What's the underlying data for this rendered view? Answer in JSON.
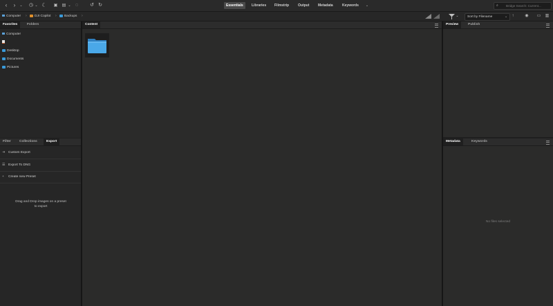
{
  "toolbar": {
    "workspaces": [
      "Essentials",
      "Libraries",
      "Filmstrip",
      "Output",
      "Metadata",
      "Keywords"
    ],
    "active_workspace": "Essentials",
    "search_placeholder": "Bridge Search: Current...",
    "icons": [
      "back-icon",
      "forward-icon",
      "chevron-down-icon",
      "recent-icon",
      "boomerang-icon",
      "camera-download-icon",
      "refine-icon",
      "open-in-camera-raw-icon",
      "rotate-left-icon",
      "rotate-right-icon",
      "workspace-more-icon",
      "search-icon"
    ]
  },
  "pathbar": {
    "crumbs": [
      "Computer",
      "DJI Copilot",
      "Backups"
    ],
    "sort_label": "Sort by Filename"
  },
  "left_top": {
    "tabs": [
      "Favorites",
      "Folders"
    ],
    "active_tab": "Favorites",
    "items": [
      "Computer",
      "",
      "Desktop",
      "Documents",
      "Pictures"
    ]
  },
  "content": {
    "tab": "Content"
  },
  "left_bottom": {
    "tabs": [
      "Filter",
      "Collections",
      "Export"
    ],
    "active_tab": "Export",
    "items": [
      "Custom Export",
      "Export To DNG",
      "Create new Preset"
    ],
    "hint": "Drag and Drop images on a preset to export"
  },
  "right_top": {
    "tabs": [
      "Preview",
      "Publish"
    ],
    "active_tab": "Preview"
  },
  "right_bottom": {
    "tabs": [
      "Metadata",
      "Keywords"
    ],
    "active_tab": "Metadata",
    "empty_message": "No files selected"
  },
  "colors": {
    "folder_blue": "#3a9ad9",
    "folder_orange": "#e0902c",
    "background": "#1f1f1f"
  }
}
